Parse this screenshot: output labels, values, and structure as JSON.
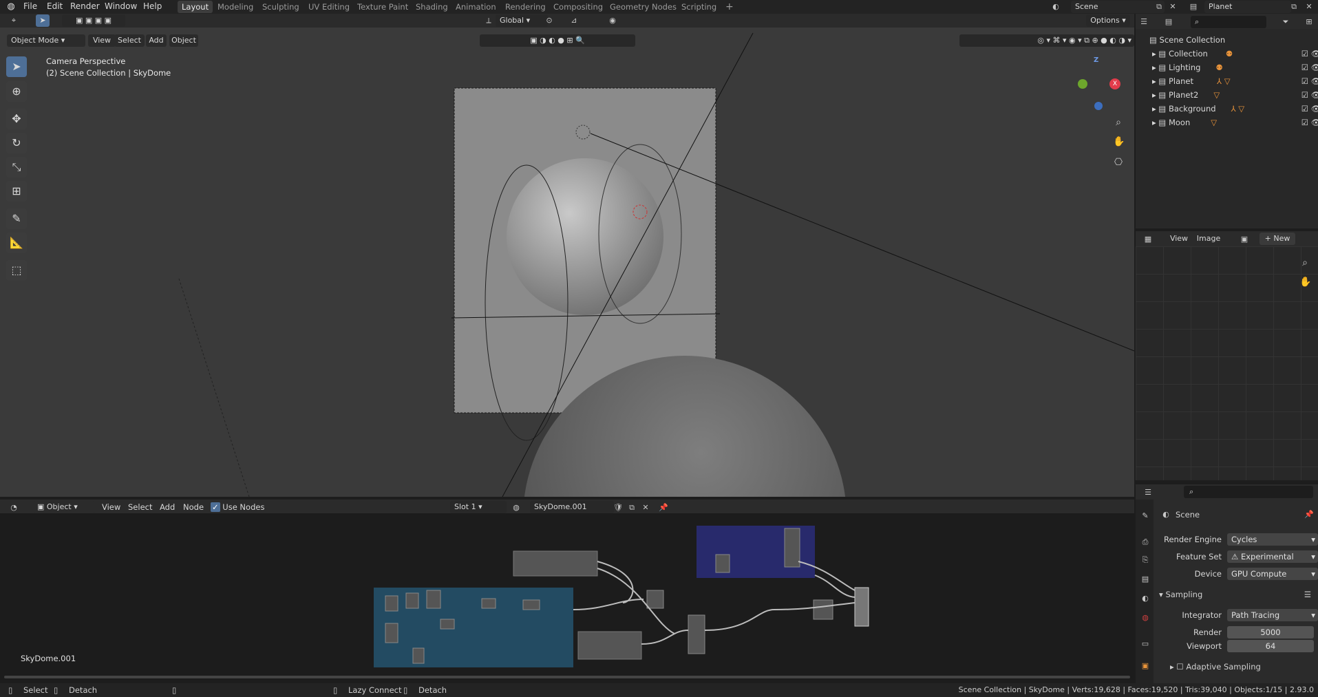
{
  "top_menu": {
    "items": [
      "File",
      "Edit",
      "Render",
      "Window",
      "Help"
    ],
    "workspaces": [
      "Layout",
      "Modeling",
      "Sculpting",
      "UV Editing",
      "Texture Paint",
      "Shading",
      "Animation",
      "Rendering",
      "Compositing",
      "Geometry Nodes",
      "Scripting"
    ],
    "active_workspace": "Layout",
    "add_tab": "+",
    "scene_name": "Scene",
    "view_layer_name": "Planet"
  },
  "viewport": {
    "mode": "Object Mode",
    "menus": [
      "View",
      "Select",
      "Add",
      "Object"
    ],
    "transform_orientation": "Global",
    "options_label": "Options",
    "overlay_line1": "Camera Perspective",
    "overlay_line2": "(2) Scene Collection | SkyDome",
    "gizmo_z": "Z",
    "gizmo_x": "X"
  },
  "outliner": {
    "root": "Scene Collection",
    "items": [
      "Collection",
      "Lighting",
      "Planet",
      "Planet2",
      "Background",
      "Moon"
    ],
    "badges": [
      "2",
      "2",
      "2 3",
      "2",
      "",
      ""
    ]
  },
  "image_editor": {
    "menus": [
      "View",
      "Image"
    ],
    "new_label": "New"
  },
  "node_editor": {
    "type": "Object",
    "menus": [
      "View",
      "Select",
      "Add",
      "Node"
    ],
    "use_nodes_label": "Use Nodes",
    "slot": "Slot 1",
    "material": "SkyDome.001",
    "footer_label": "SkyDome.001"
  },
  "properties": {
    "context": "Scene",
    "render_engine_label": "Render Engine",
    "render_engine": "Cycles",
    "feature_set_label": "Feature Set",
    "feature_set": "Experimental",
    "device_label": "Device",
    "device": "GPU Compute",
    "sampling_label": "Sampling",
    "integrator_label": "Integrator",
    "integrator": "Path Tracing",
    "render_label": "Render",
    "render_samples": "5000",
    "viewport_label": "Viewport",
    "viewport_samples": "64",
    "adaptive_label": "Adaptive Sampling"
  },
  "statusbar": {
    "select": "Select",
    "detach1": "Detach",
    "lazy_connect": "Lazy Connect",
    "detach2": "Detach",
    "stats": "Scene Collection | SkyDome | Verts:19,628 | Faces:19,520 | Tris:39,040 | Objects:1/15 | 2.93.0"
  },
  "colors": {
    "accent_blue": "#4e6f97",
    "gizmo_red": "#e23c4b",
    "gizmo_green": "#6da62c",
    "gizmo_blue": "#3c6ebe",
    "orange_icon": "#e8933a"
  }
}
